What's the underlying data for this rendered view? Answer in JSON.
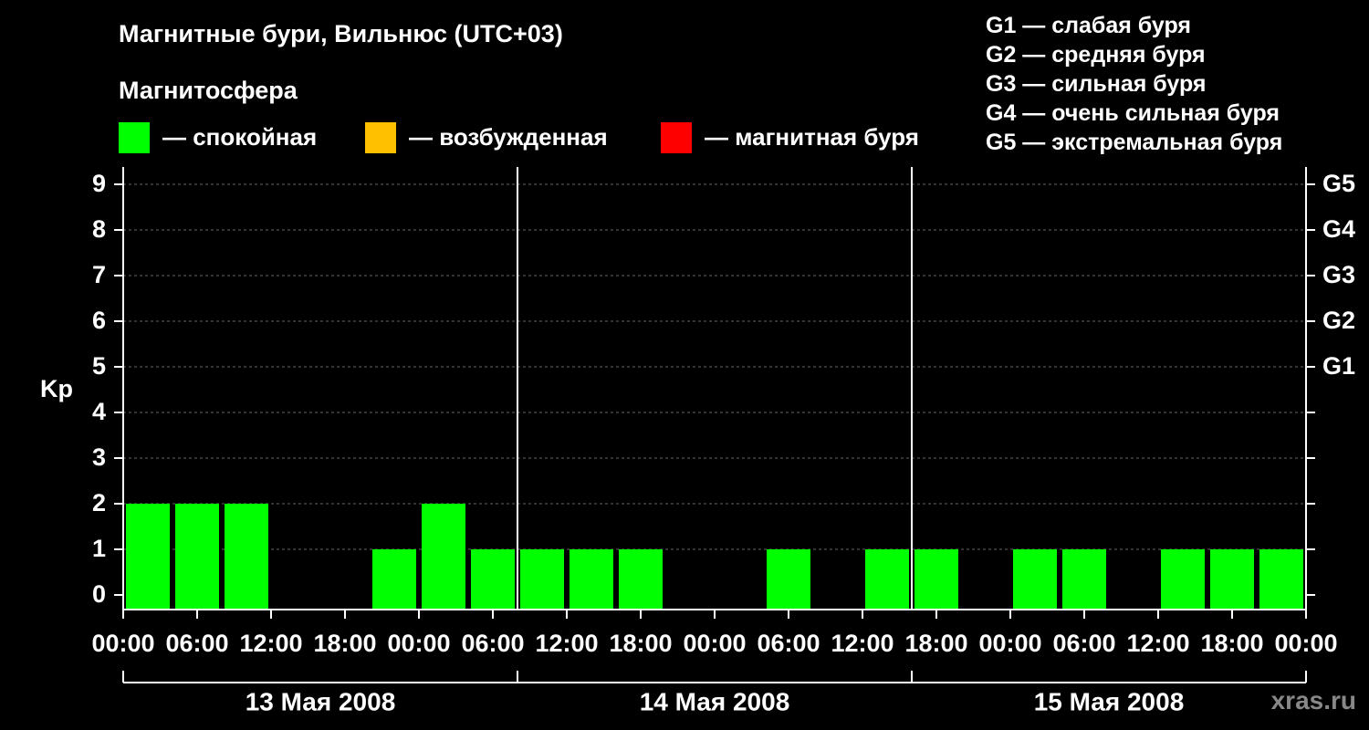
{
  "header": {
    "title": "Магнитные бури, Вильнюс (UTC+03)",
    "subtitle": "Магнитосфера"
  },
  "legend": [
    {
      "label": "— спокойная",
      "color": "#00ff00"
    },
    {
      "label": "— возбужденная",
      "color": "#ffc000"
    },
    {
      "label": "— магнитная буря",
      "color": "#ff0000"
    }
  ],
  "g_scale": [
    "G1 — слабая буря",
    "G2 — средняя буря",
    "G3 — сильная буря",
    "G4 — очень сильная буря",
    "G5 — экстремальная буря"
  ],
  "watermark": "xras.ru",
  "chart_data": {
    "type": "bar",
    "ylabel": "Kp",
    "ylim": [
      0,
      9
    ],
    "y_ticks": [
      "0",
      "1",
      "2",
      "3",
      "4",
      "5",
      "6",
      "7",
      "8",
      "9"
    ],
    "right_ticks": {
      "5": "G1",
      "6": "G2",
      "7": "G3",
      "8": "G4",
      "9": "G5"
    },
    "x_tick_labels": [
      "00:00",
      "06:00",
      "12:00",
      "18:00",
      "00:00",
      "06:00",
      "12:00",
      "18:00",
      "00:00",
      "06:00",
      "12:00",
      "18:00",
      "00:00",
      "06:00",
      "12:00",
      "18:00",
      "00:00"
    ],
    "days": [
      "13 Мая 2008",
      "14 Мая 2008",
      "15 Мая 2008"
    ],
    "interval_hours": 3,
    "values": [
      2,
      2,
      2,
      0,
      0,
      1,
      2,
      1,
      1,
      1,
      1,
      0,
      0,
      1,
      0,
      1,
      1,
      0,
      1,
      1,
      0,
      1,
      1,
      1
    ],
    "bar_color": "#00ff00",
    "grid": true
  }
}
